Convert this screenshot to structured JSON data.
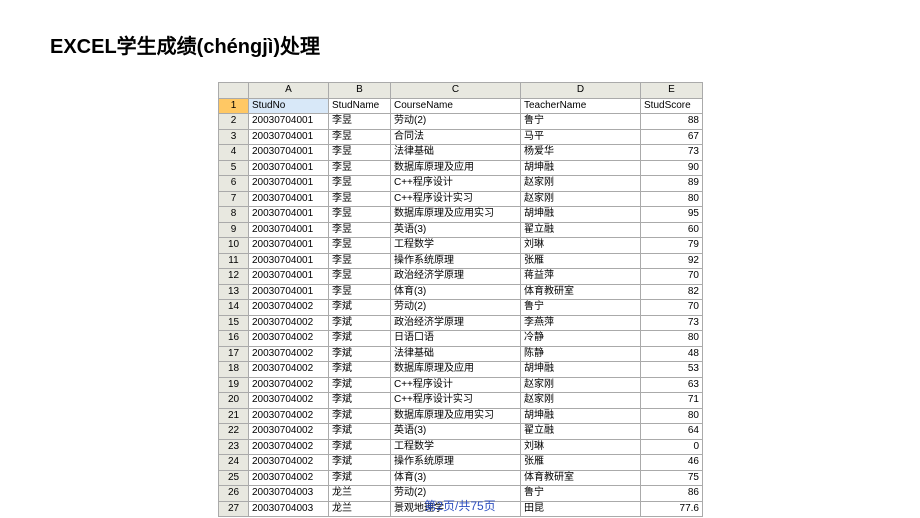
{
  "title": "EXCEL学生成绩(chéngjì)处理",
  "pager": "第2页/共75页",
  "selected_cell": {
    "row": 1,
    "col": "A"
  },
  "columns": [
    "A",
    "B",
    "C",
    "D",
    "E"
  ],
  "headers": {
    "A": "StudNo",
    "B": "StudName",
    "C": "CourseName",
    "D": "TeacherName",
    "E": "StudScore"
  },
  "rows": [
    {
      "n": 1,
      "A": "StudNo",
      "B": "StudName",
      "C": "CourseName",
      "D": "TeacherName",
      "E": "StudScore",
      "is_header": true
    },
    {
      "n": 2,
      "A": "20030704001",
      "B": "李昱",
      "C": "劳动(2)",
      "D": "鲁宁",
      "E": 88
    },
    {
      "n": 3,
      "A": "20030704001",
      "B": "李昱",
      "C": "合同法",
      "D": "马平",
      "E": 67
    },
    {
      "n": 4,
      "A": "20030704001",
      "B": "李昱",
      "C": "法律基础",
      "D": "杨爱华",
      "E": 73
    },
    {
      "n": 5,
      "A": "20030704001",
      "B": "李昱",
      "C": "数据库原理及应用",
      "D": "胡坤融",
      "E": 90
    },
    {
      "n": 6,
      "A": "20030704001",
      "B": "李昱",
      "C": "C++程序设计",
      "D": "赵家刚",
      "E": 89
    },
    {
      "n": 7,
      "A": "20030704001",
      "B": "李昱",
      "C": "C++程序设计实习",
      "D": "赵家刚",
      "E": 80
    },
    {
      "n": 8,
      "A": "20030704001",
      "B": "李昱",
      "C": "数据库原理及应用实习",
      "D": "胡坤融",
      "E": 95
    },
    {
      "n": 9,
      "A": "20030704001",
      "B": "李昱",
      "C": "英语(3)",
      "D": "翟立融",
      "E": 60
    },
    {
      "n": 10,
      "A": "20030704001",
      "B": "李昱",
      "C": "工程数学",
      "D": "刘琳",
      "E": 79
    },
    {
      "n": 11,
      "A": "20030704001",
      "B": "李昱",
      "C": "操作系统原理",
      "D": "张雁",
      "E": 92
    },
    {
      "n": 12,
      "A": "20030704001",
      "B": "李昱",
      "C": "政治经济学原理",
      "D": "蒋益萍",
      "E": 70
    },
    {
      "n": 13,
      "A": "20030704001",
      "B": "李昱",
      "C": "体育(3)",
      "D": "体育教研室",
      "E": 82
    },
    {
      "n": 14,
      "A": "20030704002",
      "B": "李斌",
      "C": "劳动(2)",
      "D": "鲁宁",
      "E": 70
    },
    {
      "n": 15,
      "A": "20030704002",
      "B": "李斌",
      "C": "政治经济学原理",
      "D": "李燕萍",
      "E": 73
    },
    {
      "n": 16,
      "A": "20030704002",
      "B": "李斌",
      "C": "日语口语",
      "D": "冷静",
      "E": 80
    },
    {
      "n": 17,
      "A": "20030704002",
      "B": "李斌",
      "C": "法律基础",
      "D": "陈静",
      "E": 48
    },
    {
      "n": 18,
      "A": "20030704002",
      "B": "李斌",
      "C": "数据库原理及应用",
      "D": "胡坤融",
      "E": 53
    },
    {
      "n": 19,
      "A": "20030704002",
      "B": "李斌",
      "C": "C++程序设计",
      "D": "赵家刚",
      "E": 63
    },
    {
      "n": 20,
      "A": "20030704002",
      "B": "李斌",
      "C": "C++程序设计实习",
      "D": "赵家刚",
      "E": 71
    },
    {
      "n": 21,
      "A": "20030704002",
      "B": "李斌",
      "C": "数据库原理及应用实习",
      "D": "胡坤融",
      "E": 80
    },
    {
      "n": 22,
      "A": "20030704002",
      "B": "李斌",
      "C": "英语(3)",
      "D": "翟立融",
      "E": 64
    },
    {
      "n": 23,
      "A": "20030704002",
      "B": "李斌",
      "C": "工程数学",
      "D": "刘琳",
      "E": 0
    },
    {
      "n": 24,
      "A": "20030704002",
      "B": "李斌",
      "C": "操作系统原理",
      "D": "张雁",
      "E": 46
    },
    {
      "n": 25,
      "A": "20030704002",
      "B": "李斌",
      "C": "体育(3)",
      "D": "体育教研室",
      "E": 75
    },
    {
      "n": 26,
      "A": "20030704003",
      "B": "龙兰",
      "C": "劳动(2)",
      "D": "鲁宁",
      "E": 86
    },
    {
      "n": 27,
      "A": "20030704003",
      "B": "龙兰",
      "C": "景观地理学",
      "D": "田昆",
      "E": 77.6
    }
  ]
}
